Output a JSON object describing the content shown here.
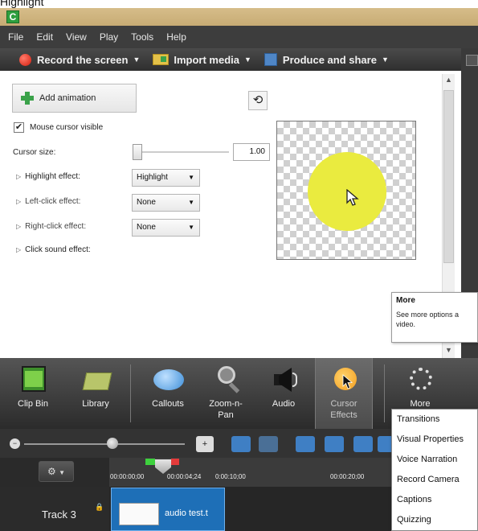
{
  "caption": "Highlight",
  "app_icon": "C",
  "menu": [
    "File",
    "Edit",
    "View",
    "Play",
    "Tools",
    "Help"
  ],
  "toolbar": {
    "record": "Record the screen",
    "import": "Import media",
    "produce": "Produce and share"
  },
  "panel": {
    "add_animation": "Add animation",
    "mouse_cursor_visible": "Mouse cursor visible",
    "cursor_size_label": "Cursor size:",
    "cursor_size_value": "1.00",
    "highlight_label": "Highlight effect:",
    "highlight_value": "Highlight",
    "left_click_label": "Left-click effect:",
    "left_click_value": "None",
    "right_click_label": "Right-click effect:",
    "right_click_value": "None",
    "click_sound_label": "Click sound effect:"
  },
  "tooltip": {
    "title": "More",
    "line1": "See more options a",
    "line2": "video."
  },
  "tabs": {
    "clip_bin": "Clip Bin",
    "library": "Library",
    "callouts": "Callouts",
    "zoom_pan_1": "Zoom-n-",
    "zoom_pan_2": "Pan",
    "audio": "Audio",
    "cursor_effects_1": "Cursor",
    "cursor_effects_2": "Effects",
    "more": "More"
  },
  "more_menu": [
    "Transitions",
    "Visual Properties",
    "Voice Narration",
    "Record Camera",
    "Captions",
    "Quizzing"
  ],
  "timeline": {
    "t0": "00:00:00;00",
    "t1": "00:00:04;24",
    "t2": "0:00:10;00",
    "t3": "00:00:20;00",
    "track_label": "Track 3",
    "clip_label": "audio test.t"
  },
  "colors": {
    "highlight": "#eaeb3f",
    "cursor_effects_accent": "#f39c1e",
    "clip": "#1e6fb7"
  }
}
